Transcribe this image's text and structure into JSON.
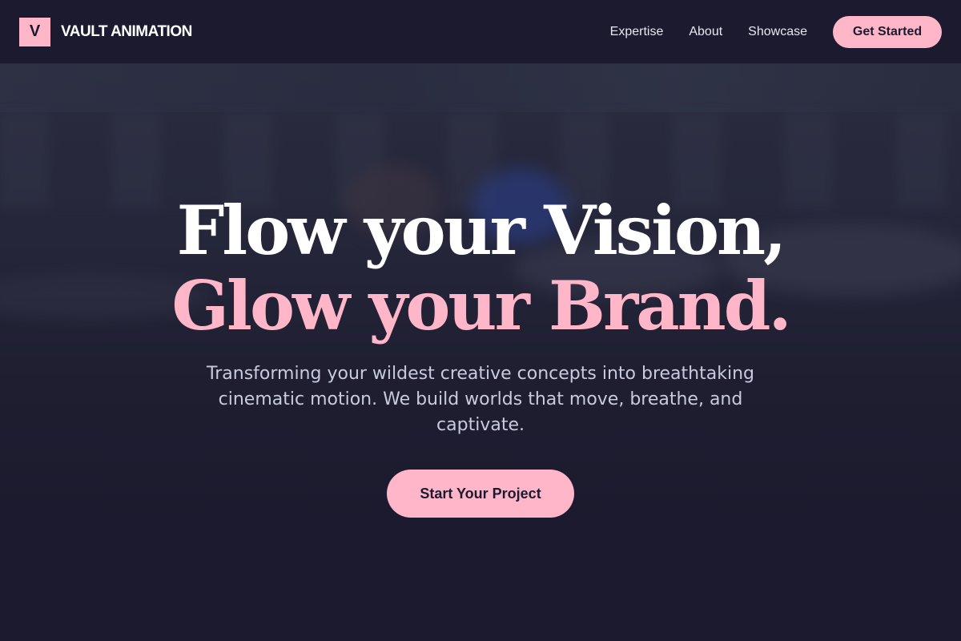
{
  "brand": {
    "logo_letter": "V",
    "name": "VAULT ANIMATION"
  },
  "nav": {
    "links": [
      {
        "label": "Expertise"
      },
      {
        "label": "About"
      },
      {
        "label": "Showcase"
      }
    ],
    "cta_label": "Get Started"
  },
  "hero": {
    "headline_line1": "Flow your Vision,",
    "headline_line2": "Glow your Brand.",
    "subtitle": "Transforming your wildest creative concepts into breathtaking cinematic motion. We build worlds that move, breathe, and captivate.",
    "cta_label": "Start Your Project",
    "background_image": "swimmer-photo"
  },
  "colors": {
    "background": "#1c1a2e",
    "accent": "#ffb6c8",
    "headline_white": "#ffffff",
    "subtitle_text": "#c8cae0"
  }
}
